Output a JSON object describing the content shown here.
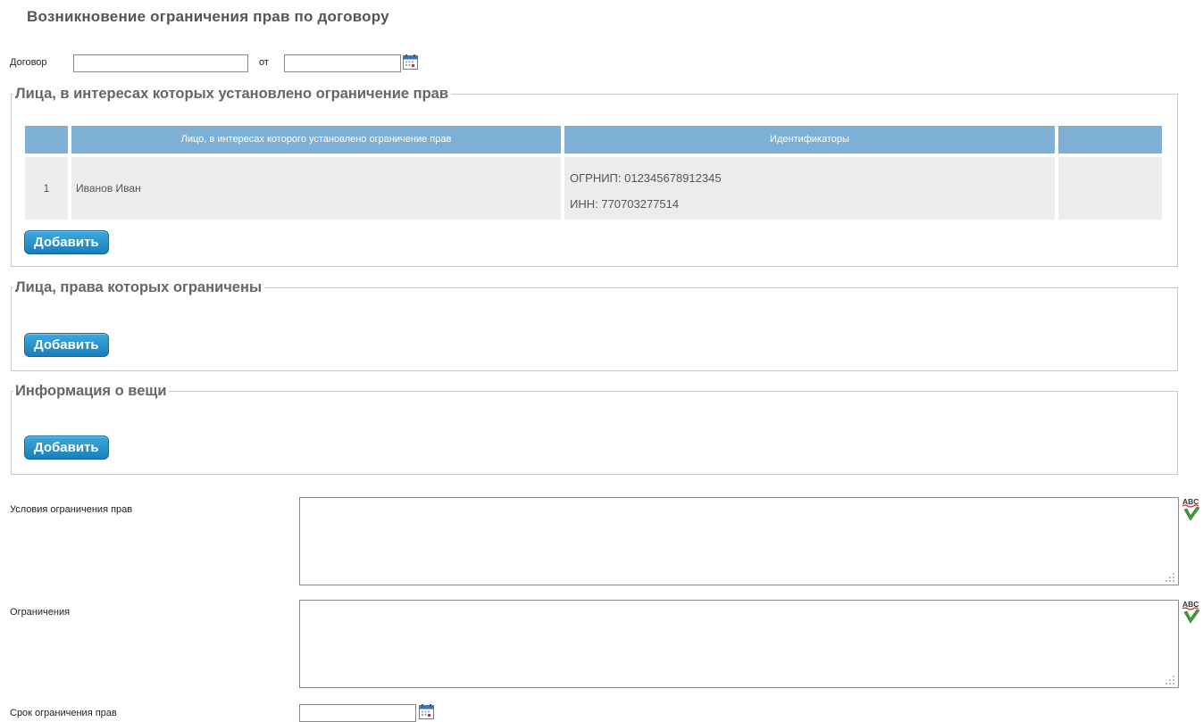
{
  "page": {
    "title": "Возникновение ограничения прав по договору"
  },
  "contract": {
    "label": "Договор",
    "number_value": "",
    "from_label": "от",
    "date_value": ""
  },
  "beneficiaries": {
    "legend": "Лица, в интересах которых установлено ограничение прав",
    "columns": [
      "",
      "Лицо, в интересах которого установлено ограничение прав",
      "Идентификаторы",
      ""
    ],
    "rows": [
      {
        "index": "1",
        "name": "Иванов Иван",
        "ids": [
          "ОГРНИП: 012345678912345",
          "ИНН: 770703277514"
        ]
      }
    ],
    "add_label": "Добавить"
  },
  "restricted": {
    "legend": "Лица, права которых ограничены",
    "add_label": "Добавить"
  },
  "thing": {
    "legend": "Информация о вещи",
    "add_label": "Добавить"
  },
  "conditions": {
    "label": "Условия ограничения прав",
    "value": ""
  },
  "restrictions": {
    "label": "Ограничения",
    "value": ""
  },
  "term": {
    "label": "Срок ограничения прав",
    "value": ""
  },
  "colors": {
    "accent": "#1a7fb9",
    "grid_header": "#7eb0d6",
    "grid_row": "#ececec"
  }
}
